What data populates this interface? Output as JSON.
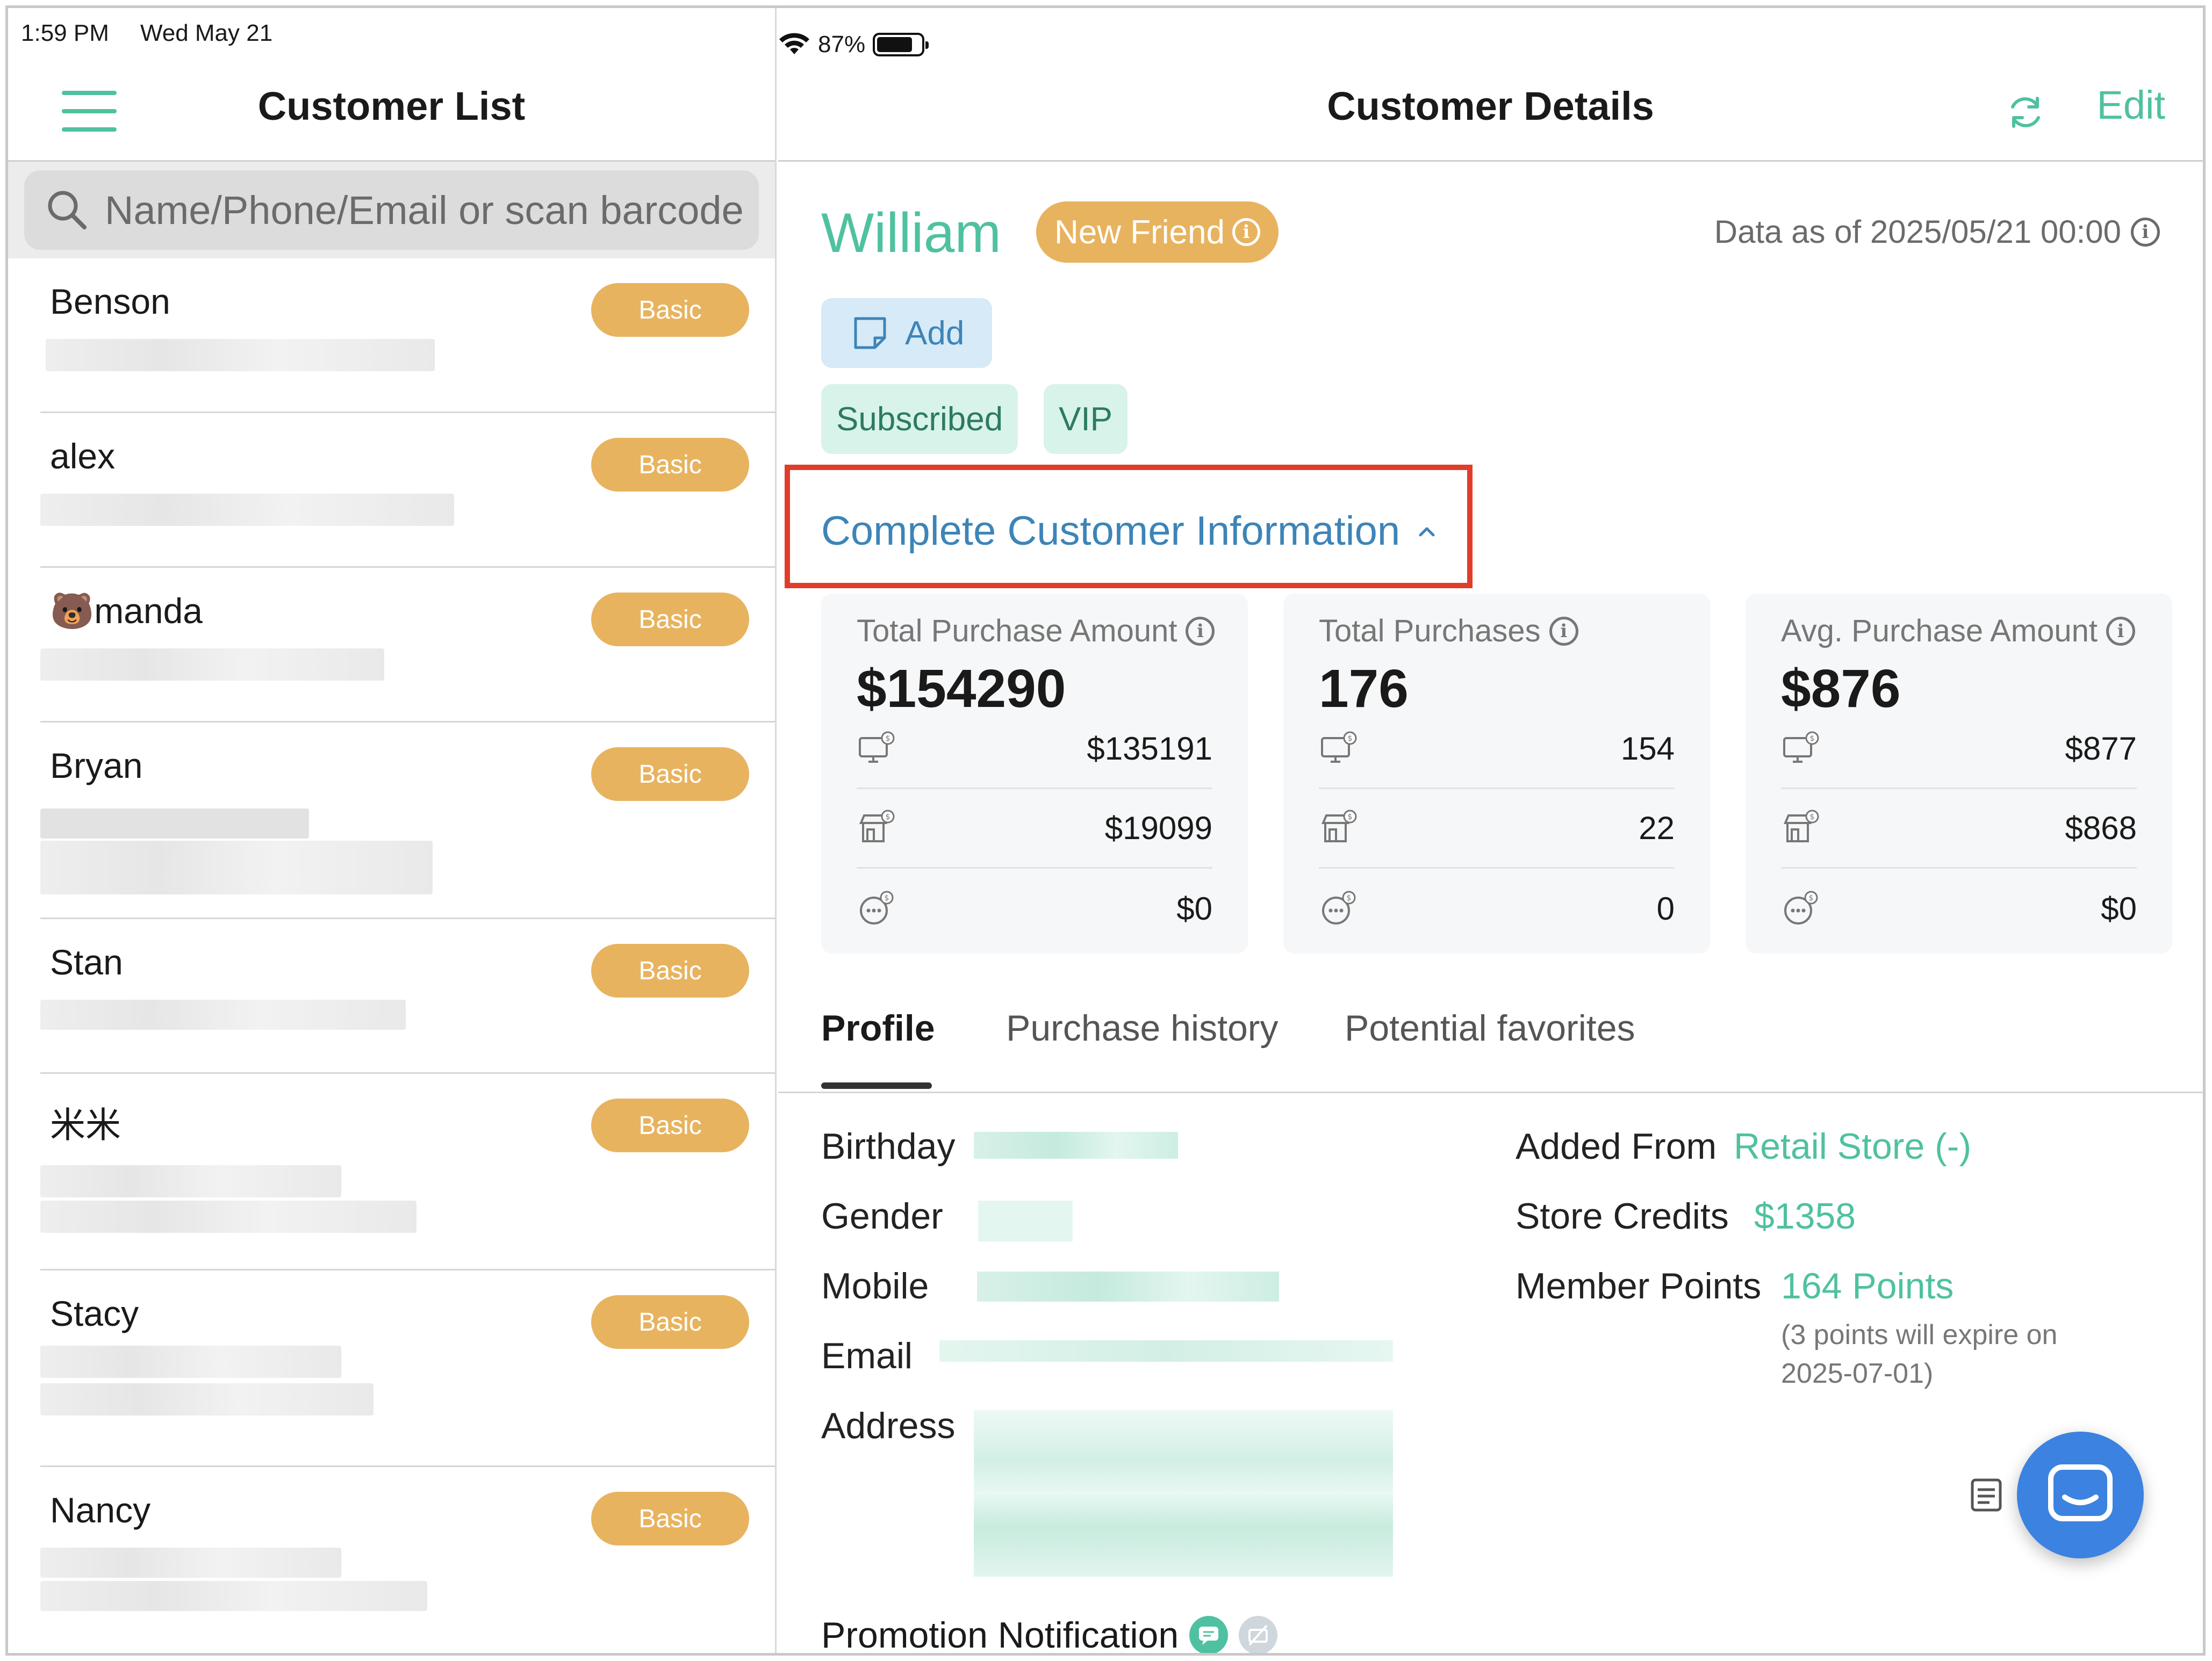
{
  "status_bar": {
    "time": "1:59 PM",
    "date": "Wed May 21",
    "battery": "87%",
    "battery_level": 0.87
  },
  "left_pane": {
    "title": "Customer List",
    "search_placeholder": "Name/Phone/Email or scan barcode",
    "customers": [
      {
        "name": "Benson",
        "tier": "Basic"
      },
      {
        "name": "alex",
        "tier": "Basic"
      },
      {
        "name": "manda",
        "tier": "Basic",
        "emoji": "🐻"
      },
      {
        "name": "Bryan",
        "tier": "Basic"
      },
      {
        "name": "Stan",
        "tier": "Basic"
      },
      {
        "name": "米米",
        "tier": "Basic"
      },
      {
        "name": "Stacy",
        "tier": "Basic"
      },
      {
        "name": "Nancy",
        "tier": "Basic"
      }
    ]
  },
  "right_pane": {
    "title": "Customer Details",
    "edit_label": "Edit",
    "customer_name": "William",
    "status_badge": "New Friend",
    "data_as_of": "Data as of 2025/05/21 00:00",
    "add_label": "Add",
    "tags": [
      "Subscribed",
      "VIP"
    ],
    "complete_info_label": "Complete Customer Information",
    "stats": [
      {
        "title": "Total Purchase Amount",
        "value": "$154290",
        "rows": [
          {
            "icon": "online-store-icon",
            "value": "$135191"
          },
          {
            "icon": "physical-store-icon",
            "value": "$19099"
          },
          {
            "icon": "other-channel-icon",
            "value": "$0"
          }
        ]
      },
      {
        "title": "Total Purchases",
        "value": "176",
        "rows": [
          {
            "icon": "online-store-icon",
            "value": "154"
          },
          {
            "icon": "physical-store-icon",
            "value": "22"
          },
          {
            "icon": "other-channel-icon",
            "value": "0"
          }
        ]
      },
      {
        "title": "Avg. Purchase Amount",
        "value": "$876",
        "rows": [
          {
            "icon": "online-store-icon",
            "value": "$877"
          },
          {
            "icon": "physical-store-icon",
            "value": "$868"
          },
          {
            "icon": "other-channel-icon",
            "value": "$0"
          }
        ]
      }
    ],
    "tabs": [
      "Profile",
      "Purchase history",
      "Potential favorites"
    ],
    "active_tab": "Profile",
    "profile": {
      "birthday_label": "Birthday",
      "gender_label": "Gender",
      "mobile_label": "Mobile",
      "email_label": "Email",
      "address_label": "Address",
      "added_from_label": "Added From",
      "added_from_value": "Retail Store (-)",
      "store_credits_label": "Store Credits",
      "store_credits_value": "$1358",
      "member_points_label": "Member Points",
      "member_points_value": "164 Points",
      "points_note_line1": "(3 points will expire on",
      "points_note_line2": "2025-07-01)",
      "promotion_label": "Promotion Notification"
    }
  },
  "colors": {
    "accent_green": "#4fc1a0",
    "badge_orange": "#e8b35f",
    "link_blue": "#3d84b8",
    "highlight_red": "#e03d2b",
    "fab_blue": "#3c82e0"
  }
}
